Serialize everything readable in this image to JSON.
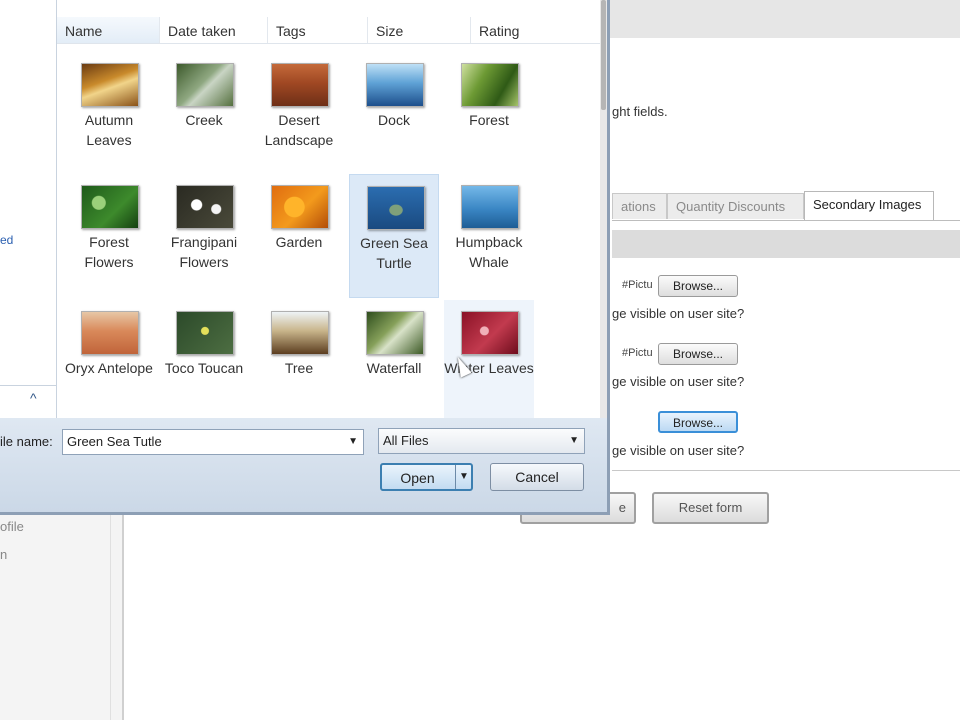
{
  "background_page": {
    "hint_text": "ght fields.",
    "tabs": [
      "ations",
      "Quantity Discounts",
      "Secondary Images"
    ],
    "image_rows": [
      {
        "path_text": "#Pictu",
        "browse_label": "Browse...",
        "visible_text": "ge visible on user site?"
      },
      {
        "path_text": "#Pictu",
        "browse_label": "Browse...",
        "visible_text": "ge visible on user site?"
      },
      {
        "path_text": "",
        "browse_label": "Browse...",
        "visible_text": "ge visible on user site?"
      }
    ],
    "submit_label": "e",
    "reset_label": "Reset form",
    "left_items": [
      "ofile",
      "n"
    ]
  },
  "dialog": {
    "nav_link_text": "ed",
    "columns": [
      "Name",
      "Date taken",
      "Tags",
      "Size",
      "Rating"
    ],
    "files": [
      {
        "name": "Autumn Leaves",
        "thumb": "t-autumn"
      },
      {
        "name": "Creek",
        "thumb": "t-creek"
      },
      {
        "name": "Desert Landscape",
        "thumb": "t-desert"
      },
      {
        "name": "Dock",
        "thumb": "t-dock"
      },
      {
        "name": "Forest",
        "thumb": "t-forest"
      },
      {
        "name": "Forest Flowers",
        "thumb": "t-fflowers"
      },
      {
        "name": "Frangipani Flowers",
        "thumb": "t-frangi"
      },
      {
        "name": "Garden",
        "thumb": "t-garden"
      },
      {
        "name": "Green Sea Turtle",
        "thumb": "t-turtle"
      },
      {
        "name": "Humpback Whale",
        "thumb": "t-whale"
      },
      {
        "name": "Oryx Antelope",
        "thumb": "t-oryx"
      },
      {
        "name": "Toco Toucan",
        "thumb": "t-toucan"
      },
      {
        "name": "Tree",
        "thumb": "t-tree"
      },
      {
        "name": "Waterfall",
        "thumb": "t-waterfall"
      },
      {
        "name": "Winter Leaves",
        "thumb": "t-winter"
      }
    ],
    "selected_file": "Green Sea Turtle",
    "hovered_file": "Winter Leaves",
    "file_name_label": "ile name:",
    "file_name_value": "Green Sea Tutle",
    "filter_value": "All Files",
    "open_label": "Open",
    "cancel_label": "Cancel",
    "chevron_icon": "chevron-up-icon",
    "dropdown_icon": "chevron-down-icon"
  },
  "colors": {
    "selection": "#dce9f7",
    "dialog_chrome": "#cfdbe9",
    "focus_border": "#3a8fd8"
  }
}
